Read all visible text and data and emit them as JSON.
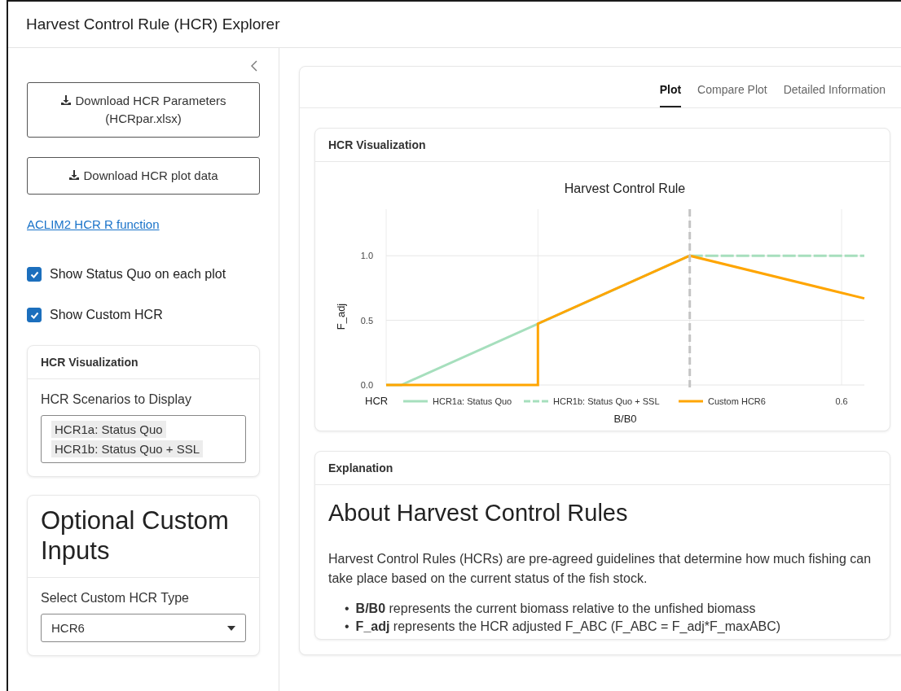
{
  "window": {
    "title": "Harvest Control Rule (HCR) Explorer"
  },
  "sidebar": {
    "buttons": [
      {
        "label": "Download HCR Parameters (HCRpar.xlsx)"
      },
      {
        "label": "Download HCR plot data"
      }
    ],
    "link": "ACLIM2 HCR R function",
    "checkboxes": [
      {
        "label": "Show Status Quo on each plot",
        "checked": true
      },
      {
        "label": "Show Custom HCR",
        "checked": true
      }
    ],
    "visualization_card": {
      "title": "HCR Visualization",
      "field_label": "HCR Scenarios to Display",
      "selected_items": [
        "HCR1a: Status Quo",
        "HCR1b: Status Quo + SSL"
      ]
    },
    "custom_inputs_card": {
      "title": "Optional Custom Inputs",
      "field_label": "Select Custom HCR Type",
      "select_value": "HCR6"
    }
  },
  "main": {
    "tabs": [
      {
        "label": "Plot",
        "selected": true
      },
      {
        "label": "Compare Plot",
        "selected": false
      },
      {
        "label": "Detailed Information",
        "selected": false
      }
    ],
    "plot_card": {
      "title": "HCR Visualization",
      "chart_title": "Harvest Control Rule",
      "y_label": "F_adj",
      "x_label": "B/B0",
      "y_ticks": [
        "1.0",
        "0.5",
        "0.0"
      ],
      "x_ticks": [
        "0.6"
      ],
      "legend": {
        "title": "HCR",
        "items": [
          {
            "label": "HCR1a: Status Quo",
            "color": "#a6dfbd",
            "kind": "solid"
          },
          {
            "label": "HCR1b: Status Quo + SSL",
            "color": "#a6dfbd",
            "kind": "dashed"
          },
          {
            "label": "Custom HCR6",
            "color": "#ffa500",
            "kind": "solid"
          }
        ]
      }
    },
    "explanation_card": {
      "title": "Explanation",
      "heading": "About Harvest Control Rules",
      "paragraph": "Harvest Control Rules (HCRs) are pre-agreed guidelines that determine how much fishing can take place based on the current status of the fish stock.",
      "bullets": [
        {
          "marker": "•",
          "text": "**B/B0** represents the current biomass relative to the unfished biomass"
        },
        {
          "marker": "•",
          "text": "**F_adj** represents the HCR adjusted F_ABC (F_ABC = F_adj*F_maxABC)"
        }
      ]
    }
  }
}
